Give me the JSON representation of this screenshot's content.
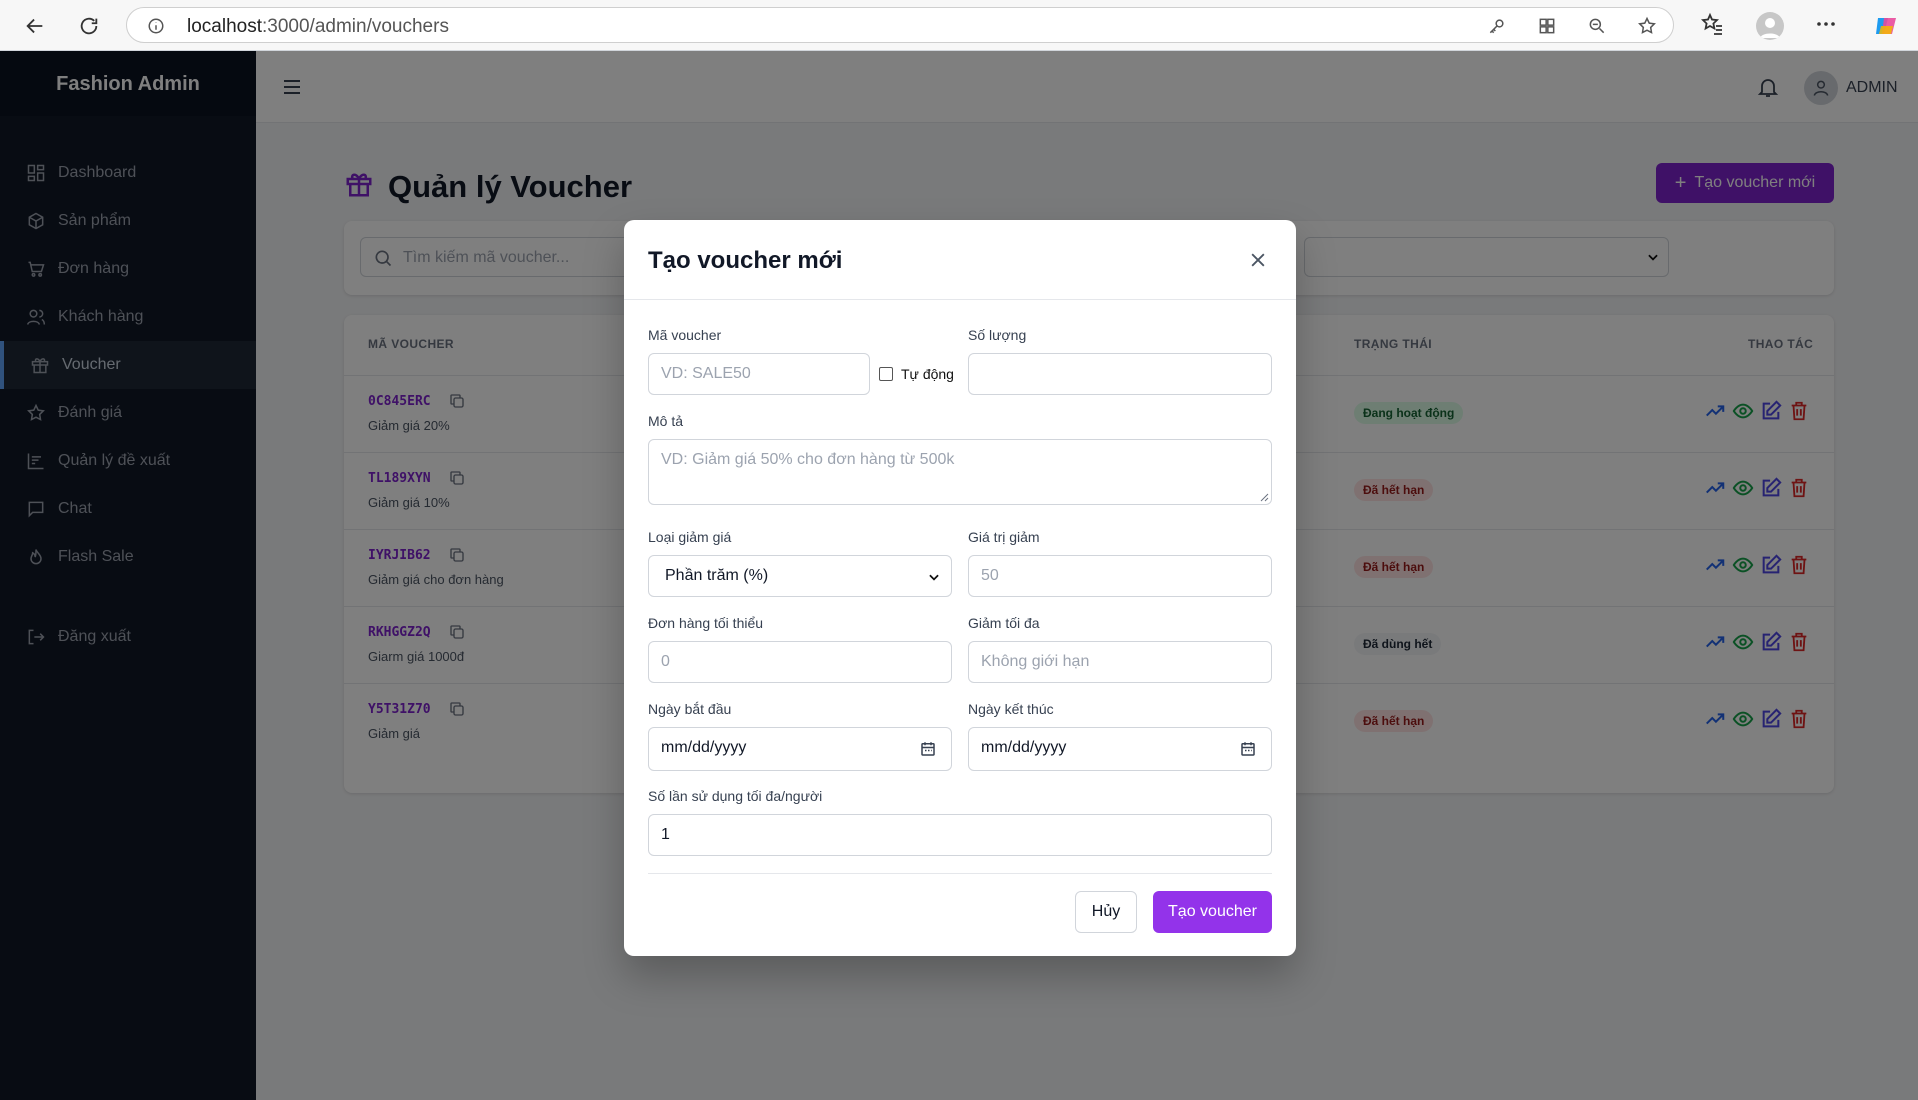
{
  "browser": {
    "url_host": "localhost",
    "url_path": ":3000/admin/vouchers"
  },
  "sidebar": {
    "brand": "Fashion Admin",
    "items": [
      {
        "label": "Dashboard",
        "icon": "grid-icon"
      },
      {
        "label": "Sản phẩm",
        "icon": "box-icon"
      },
      {
        "label": "Đơn hàng",
        "icon": "cart-icon"
      },
      {
        "label": "Khách hàng",
        "icon": "users-icon"
      },
      {
        "label": "Voucher",
        "icon": "gift-icon",
        "active": true
      },
      {
        "label": "Đánh giá",
        "icon": "star-icon"
      },
      {
        "label": "Quản lý đề xuất",
        "icon": "chart-icon"
      },
      {
        "label": "Chat",
        "icon": "chat-icon"
      },
      {
        "label": "Flash Sale",
        "icon": "flame-icon"
      }
    ],
    "logout": "Đăng xuất"
  },
  "topbar": {
    "user": "ADMIN"
  },
  "page": {
    "title": "Quản lý Voucher",
    "new_button": "Tạo voucher mới",
    "search_placeholder": "Tìm kiếm mã voucher..."
  },
  "table": {
    "headers": {
      "code": "MÃ VOUCHER",
      "status": "TRẠNG THÁI",
      "actions": "THAO TÁC"
    },
    "rows": [
      {
        "code": "0C845ERC",
        "desc": "Giảm giá 20%",
        "status": "Đang hoạt động",
        "status_kind": "active"
      },
      {
        "code": "TL189XYN",
        "desc": "Giảm giá 10%",
        "status": "Đã hết hạn",
        "status_kind": "expired"
      },
      {
        "code": "IYRJIB62",
        "desc": "Giảm giá cho đơn hàng",
        "status": "Đã hết hạn",
        "status_kind": "expired"
      },
      {
        "code": "RKHGGZ2Q",
        "desc": "Giarm giá 1000đ",
        "status": "Đã dùng hết",
        "status_kind": "used"
      },
      {
        "code": "Y5T31Z70",
        "desc": "Giảm giá",
        "status": "Đã hết hạn",
        "status_kind": "expired"
      }
    ]
  },
  "modal": {
    "title": "Tạo voucher mới",
    "code_label": "Mã voucher",
    "code_placeholder": "VD: SALE50",
    "auto_label": "Tự động",
    "auto_checked": false,
    "quantity_label": "Số lượng",
    "quantity_value": "",
    "desc_label": "Mô tả",
    "desc_placeholder": "VD: Giảm giá 50% cho đơn hàng từ 500k",
    "type_label": "Loại giảm giá",
    "type_value": "Phần trăm (%)",
    "value_label": "Giá trị giảm",
    "value_placeholder": "50",
    "min_label": "Đơn hàng tối thiểu",
    "min_placeholder": "0",
    "max_label": "Giảm tối đa",
    "max_placeholder": "Không giới hạn",
    "start_label": "Ngày bắt đầu",
    "start_placeholder": "mm/dd/yyyy",
    "end_label": "Ngày kết thúc",
    "end_placeholder": "mm/dd/yyyy",
    "per_user_label": "Số lần sử dụng tối đa/người",
    "per_user_value": "1",
    "cancel": "Hủy",
    "submit": "Tạo voucher"
  },
  "colors": {
    "accent": "#9333ea",
    "sidebar": "#111827",
    "active_badge_bg": "#dcfce7",
    "active_badge_fg": "#166534",
    "expired_badge_bg": "#fee2e2",
    "expired_badge_fg": "#991b1b",
    "used_badge_bg": "#f3f4f6",
    "used_badge_fg": "#1f2937"
  }
}
